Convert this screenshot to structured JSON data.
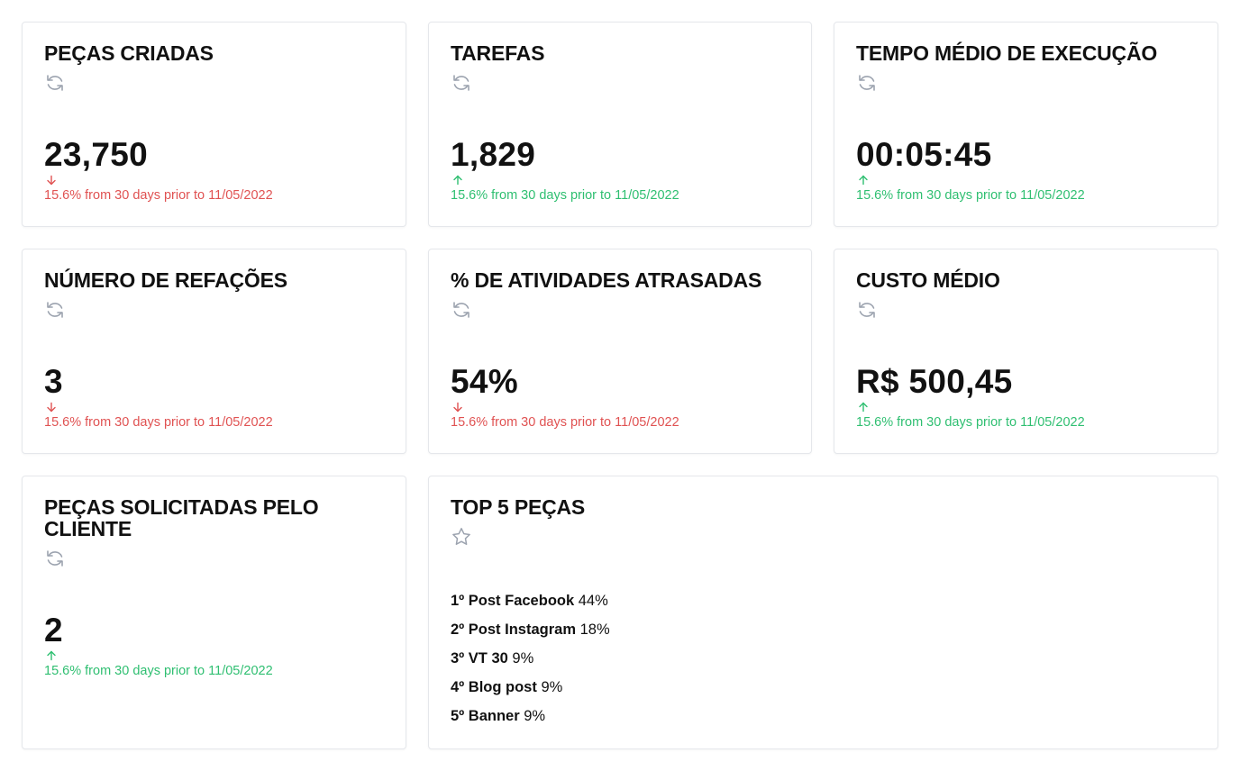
{
  "colors": {
    "down": "#e05252",
    "up": "#2fbf71",
    "icon": "#9ca3af"
  },
  "cards": [
    {
      "title": "PEÇAS CRIADAS",
      "icon": "refresh-icon",
      "value": "23,750",
      "trend": "down",
      "trend_text": "15.6% from 30 days prior to 11/05/2022"
    },
    {
      "title": "TAREFAS",
      "icon": "refresh-icon",
      "value": "1,829",
      "trend": "up",
      "trend_text": "15.6% from 30 days prior to 11/05/2022"
    },
    {
      "title": "TEMPO MÉDIO DE EXECUÇÃO",
      "icon": "refresh-icon",
      "value": "00:05:45",
      "trend": "up",
      "trend_text": "15.6% from 30 days prior to 11/05/2022"
    },
    {
      "title": "NÚMERO DE REFAÇÕES",
      "icon": "refresh-icon",
      "value": "3",
      "trend": "down",
      "trend_text": "15.6% from 30 days prior to 11/05/2022"
    },
    {
      "title": "% DE ATIVIDADES ATRASADAS",
      "icon": "refresh-icon",
      "value": "54%",
      "trend": "down",
      "trend_text": "15.6% from 30 days prior to 11/05/2022"
    },
    {
      "title": "CUSTO MÉDIO",
      "icon": "refresh-icon",
      "value": "R$ 500,45",
      "trend": "up",
      "trend_text": "15.6% from 30 days prior to 11/05/2022"
    },
    {
      "title": "PEÇAS SOLICITADAS PELO CLIENTE",
      "icon": "refresh-icon",
      "value": "2",
      "trend": "up",
      "trend_text": "15.6% from 30 days prior to 11/05/2022"
    }
  ],
  "top5": {
    "title": "TOP 5 PEÇAS",
    "icon": "star-icon",
    "items": [
      {
        "rank_label": "1º Post Facebook",
        "percent": "44%"
      },
      {
        "rank_label": "2º Post Instagram",
        "percent": "18%"
      },
      {
        "rank_label": "3º VT 30",
        "percent": "9%"
      },
      {
        "rank_label": "4º Blog post",
        "percent": "9%"
      },
      {
        "rank_label": "5º Banner",
        "percent": "9%"
      }
    ]
  }
}
